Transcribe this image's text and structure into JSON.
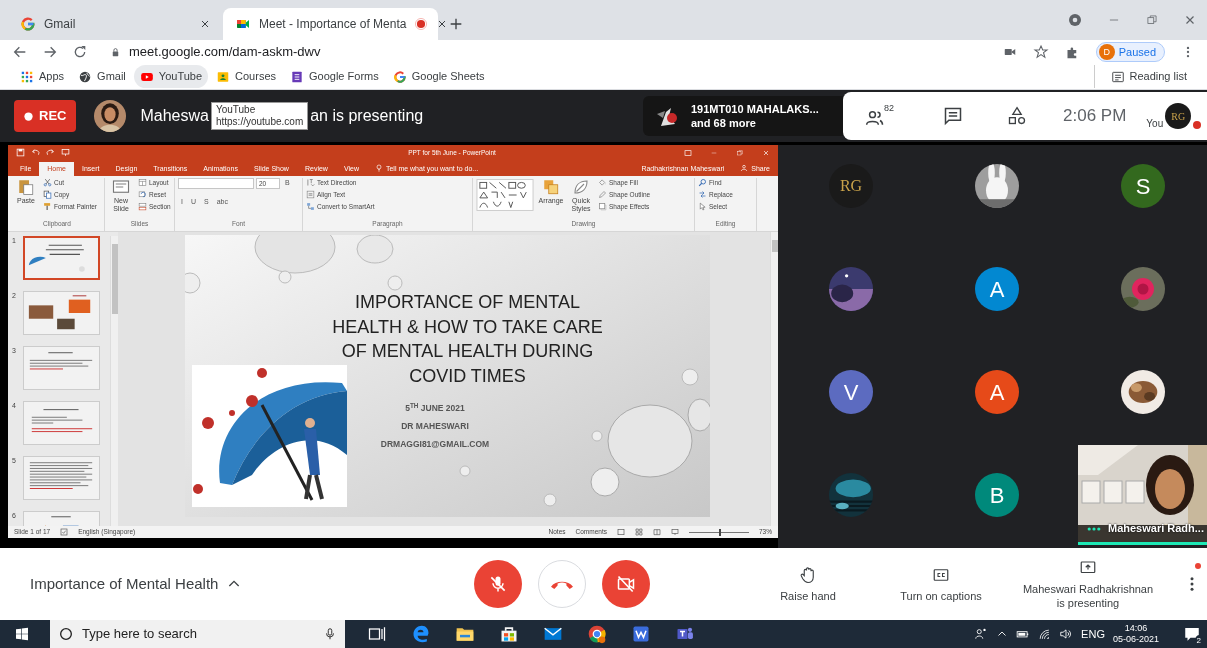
{
  "browser": {
    "tabs": [
      {
        "title": "Gmail",
        "selected": false,
        "recording": false
      },
      {
        "title": "Meet - Importance of Menta",
        "selected": true,
        "recording": true
      }
    ],
    "address": "meet.google.com/dam-askm-dwv",
    "profile": {
      "initial": "D",
      "status": "Paused"
    },
    "bookmarks": [
      {
        "label": "Apps",
        "kind": "apps",
        "hovered": false
      },
      {
        "label": "Gmail",
        "kind": "globe",
        "hovered": false
      },
      {
        "label": "YouTube",
        "kind": "youtube",
        "hovered": true
      },
      {
        "label": "Courses",
        "kind": "courses",
        "hovered": false
      },
      {
        "label": "Google Forms",
        "kind": "forms",
        "hovered": false
      },
      {
        "label": "Google Sheets",
        "kind": "google",
        "hovered": false
      }
    ],
    "reading_list": "Reading list"
  },
  "meet_header": {
    "rec": "REC",
    "presenter_start": "Maheswa",
    "presenter_end": "an is presenting",
    "link_tooltip": {
      "title": "YouTube",
      "url": "https://youtube.com"
    },
    "pinned": {
      "name": "191MT010 MAHALAKS...",
      "more": "and 68 more"
    },
    "participant_count": "82",
    "time": "2:06 PM",
    "self_label": "You",
    "self_initials": "RG"
  },
  "powerpoint": {
    "title": "PPT for 5th June - PowerPoint",
    "tabs": [
      {
        "label": "File",
        "selected": false
      },
      {
        "label": "Home",
        "selected": true
      },
      {
        "label": "Insert",
        "selected": false
      },
      {
        "label": "Design",
        "selected": false
      },
      {
        "label": "Transitions",
        "selected": false
      },
      {
        "label": "Animations",
        "selected": false
      },
      {
        "label": "Slide Show",
        "selected": false
      },
      {
        "label": "Review",
        "selected": false
      },
      {
        "label": "View",
        "selected": false
      }
    ],
    "tell_me": "Tell me what you want to do...",
    "user": "Radhakrishnan Maheswari",
    "share": "Share",
    "groups": [
      {
        "label": "Clipboard",
        "items": [
          {
            "kind": "large",
            "label": "Paste"
          },
          {
            "kind": "small",
            "label": "Cut"
          },
          {
            "kind": "small",
            "label": "Copy"
          },
          {
            "kind": "small",
            "label": "Format Painter"
          }
        ]
      },
      {
        "label": "Slides",
        "items": [
          {
            "kind": "large",
            "label": "New Slide"
          },
          {
            "kind": "small",
            "label": "Layout"
          },
          {
            "kind": "small",
            "label": "Reset"
          },
          {
            "kind": "small",
            "label": "Section"
          }
        ]
      },
      {
        "label": "Font",
        "items": [
          {
            "kind": "field"
          },
          {
            "kind": "field",
            "value": "20"
          },
          {
            "kind": "format",
            "label": "B"
          },
          {
            "kind": "format",
            "label": "I"
          },
          {
            "kind": "format",
            "label": "U"
          },
          {
            "kind": "format",
            "label": "S"
          },
          {
            "kind": "format",
            "label": "abc"
          }
        ]
      },
      {
        "label": "Paragraph",
        "items": [
          {
            "kind": "small",
            "label": "Text Direction"
          },
          {
            "kind": "small",
            "label": "Align Text"
          },
          {
            "kind": "small",
            "label": "Convert to SmartArt"
          }
        ]
      },
      {
        "label": "Drawing",
        "items": [
          {
            "kind": "shapes"
          },
          {
            "kind": "large",
            "label": "Arrange"
          },
          {
            "kind": "large",
            "label": "Quick Styles"
          },
          {
            "kind": "small",
            "label": "Shape Fill"
          },
          {
            "kind": "small",
            "label": "Shape Outline"
          },
          {
            "kind": "small",
            "label": "Shape Effects"
          }
        ]
      },
      {
        "label": "Editing",
        "items": [
          {
            "kind": "small",
            "label": "Find"
          },
          {
            "kind": "small",
            "label": "Replace"
          },
          {
            "kind": "small",
            "label": "Select"
          }
        ]
      }
    ],
    "thumbnails": [
      {
        "number": "1",
        "selected": true
      },
      {
        "number": "2",
        "selected": false
      },
      {
        "number": "3",
        "selected": false
      },
      {
        "number": "4",
        "selected": false
      },
      {
        "number": "5",
        "selected": false
      },
      {
        "number": "6",
        "selected": false
      }
    ],
    "slide": {
      "title": "IMPORTANCE OF MENTAL\nHEALTH & HOW TO TAKE CARE\nOF MENTAL HEALTH DURING\nCOVID TIMES",
      "date": "5$^{TH}$ JUNE 2021",
      "author": "DR MAHESWARI",
      "email": "DRMAGGI81@GMAIL.COM"
    },
    "status": {
      "slide_count": "Slide 1 of 17",
      "language": "English (Singapore)",
      "notes": "Notes",
      "comments": "Comments",
      "zoom": "73%",
      "level": 0.5
    }
  },
  "participants": [
    {
      "kind": "letter",
      "letter": "RG",
      "color": "#1a1a1a"
    },
    {
      "kind": "picture"
    },
    {
      "kind": "letter",
      "letter": "S",
      "color": "#33691e"
    },
    {
      "kind": "picture"
    },
    {
      "kind": "letter",
      "letter": "A",
      "color": "#0288d1"
    },
    {
      "kind": "picture"
    },
    {
      "kind": "letter",
      "letter": "V",
      "color": "#5c6bc0"
    },
    {
      "kind": "letter",
      "letter": "A",
      "color": "#e64a19"
    },
    {
      "kind": "picture"
    },
    {
      "kind": "picture"
    },
    {
      "kind": "letter",
      "letter": "B",
      "color": "#00897b"
    }
  ],
  "self_view": {
    "name": "Maheswari Radh..."
  },
  "controls": {
    "meeting_title": "Importance of Mental Health",
    "mic_muted": true,
    "camera_off": true,
    "raise_hand": "Raise hand",
    "captions": "Turn on captions",
    "presenting": "Maheswari Radhakrishnan\nis presenting"
  },
  "taskbar": {
    "search_placeholder": "Type here to search",
    "language": "ENG",
    "time": "14:06",
    "date": "05-06-2021",
    "notifications": "2"
  }
}
